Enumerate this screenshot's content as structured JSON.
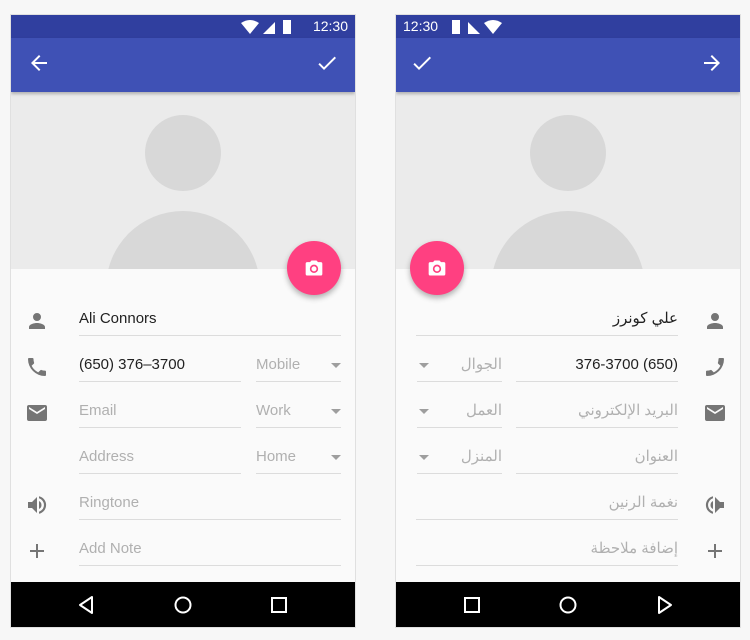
{
  "colors": {
    "status_bar": "#303f9f",
    "toolbar": "#3f51b5",
    "fab": "#ff4081"
  },
  "ltr": {
    "status_time": "12:30",
    "toolbar": {
      "back_icon": "arrow-left-icon",
      "save_icon": "check-icon"
    },
    "fab_icon": "camera-icon",
    "name": {
      "value": "Ali Connors",
      "icon": "person-icon"
    },
    "phone": {
      "value": "(650) 376–3700",
      "type": "Mobile",
      "icon": "phone-icon"
    },
    "email": {
      "placeholder": "Email",
      "type": "Work",
      "icon": "email-icon"
    },
    "address": {
      "placeholder": "Address",
      "type": "Home",
      "icon": "location-icon"
    },
    "ringtone": {
      "placeholder": "Ringtone",
      "icon": "volume-icon"
    },
    "note": {
      "placeholder": "Add Note",
      "icon": "plus-icon"
    }
  },
  "rtl": {
    "status_time": "12:30",
    "toolbar": {
      "back_icon": "arrow-right-icon",
      "save_icon": "check-icon"
    },
    "fab_icon": "camera-icon",
    "name": {
      "value": "علي كونرز",
      "icon": "person-icon"
    },
    "phone": {
      "value": "(650) 376-3700",
      "type": "الجوال",
      "icon": "phone-icon"
    },
    "email": {
      "placeholder": "البريد الإلكتروني",
      "type": "العمل",
      "icon": "email-icon"
    },
    "address": {
      "placeholder": "العنوان",
      "type": "المنزل",
      "icon": "location-icon"
    },
    "ringtone": {
      "placeholder": "نغمة الرنين",
      "icon": "volume-icon"
    },
    "note": {
      "placeholder": "إضافة ملاحظة",
      "icon": "plus-icon"
    }
  }
}
